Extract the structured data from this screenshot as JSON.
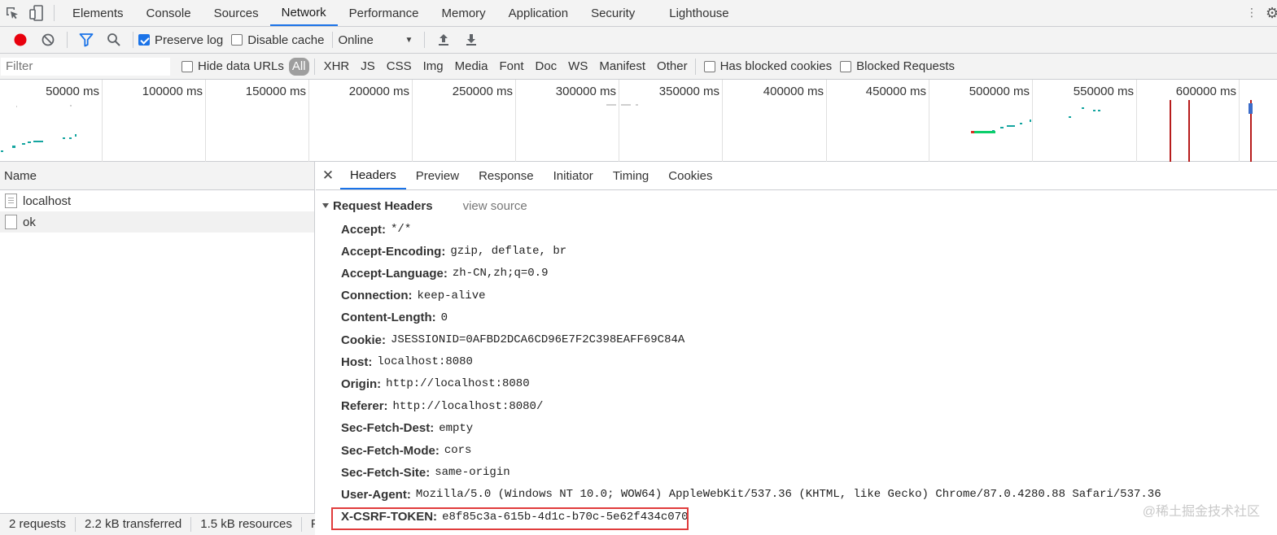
{
  "topbar": {
    "tabs": [
      "Elements",
      "Console",
      "Sources",
      "Network",
      "Performance",
      "Memory",
      "Application",
      "Security",
      "Lighthouse"
    ],
    "active_tab": "Network"
  },
  "toolbar": {
    "preserve_log_label": "Preserve log",
    "preserve_log_checked": true,
    "disable_cache_label": "Disable cache",
    "disable_cache_checked": false,
    "throttle_value": "Online"
  },
  "filterbar": {
    "filter_placeholder": "Filter",
    "hide_data_urls_label": "Hide data URLs",
    "types": [
      "All",
      "XHR",
      "JS",
      "CSS",
      "Img",
      "Media",
      "Font",
      "Doc",
      "WS",
      "Manifest",
      "Other"
    ],
    "active_type": "All",
    "has_blocked_cookies_label": "Has blocked cookies",
    "blocked_requests_label": "Blocked Requests"
  },
  "overview": {
    "ticks": [
      "50000 ms",
      "100000 ms",
      "150000 ms",
      "200000 ms",
      "250000 ms",
      "300000 ms",
      "350000 ms",
      "400000 ms",
      "450000 ms",
      "500000 ms",
      "550000 ms",
      "600000 ms"
    ]
  },
  "requests": {
    "header": "Name",
    "items": [
      {
        "name": "localhost",
        "selected": false
      },
      {
        "name": "ok",
        "selected": true
      }
    ]
  },
  "statusbar": {
    "requests": "2 requests",
    "transferred": "2.2 kB transferred",
    "resources": "1.5 kB resources",
    "more": "Fi"
  },
  "details": {
    "tabs": [
      "Headers",
      "Preview",
      "Response",
      "Initiator",
      "Timing",
      "Cookies"
    ],
    "active_tab": "Headers",
    "section_title": "Request Headers",
    "view_source": "view source",
    "headers": [
      {
        "name": "Accept:",
        "value": "*/*"
      },
      {
        "name": "Accept-Encoding:",
        "value": "gzip, deflate, br"
      },
      {
        "name": "Accept-Language:",
        "value": "zh-CN,zh;q=0.9"
      },
      {
        "name": "Connection:",
        "value": "keep-alive"
      },
      {
        "name": "Content-Length:",
        "value": "0"
      },
      {
        "name": "Cookie:",
        "value": "JSESSIONID=0AFBD2DCA6CD96E7F2C398EAFF69C84A"
      },
      {
        "name": "Host:",
        "value": "localhost:8080"
      },
      {
        "name": "Origin:",
        "value": "http://localhost:8080"
      },
      {
        "name": "Referer:",
        "value": "http://localhost:8080/"
      },
      {
        "name": "Sec-Fetch-Dest:",
        "value": "empty"
      },
      {
        "name": "Sec-Fetch-Mode:",
        "value": "cors"
      },
      {
        "name": "Sec-Fetch-Site:",
        "value": "same-origin"
      },
      {
        "name": "User-Agent:",
        "value": "Mozilla/5.0 (Windows NT 10.0; WOW64) AppleWebKit/537.36 (KHTML, like Gecko) Chrome/87.0.4280.88 Safari/537.36"
      },
      {
        "name": "X-CSRF-TOKEN:",
        "value": "e8f85c3a-615b-4d1c-b70c-5e62f434c070"
      }
    ],
    "highlighted_header": "X-CSRF-TOKEN:"
  },
  "watermark": "@稀土掘金技术社区",
  "colors": {
    "accent": "#1a73e8",
    "record": "#e8000d",
    "highlight": "#e03c3c"
  }
}
